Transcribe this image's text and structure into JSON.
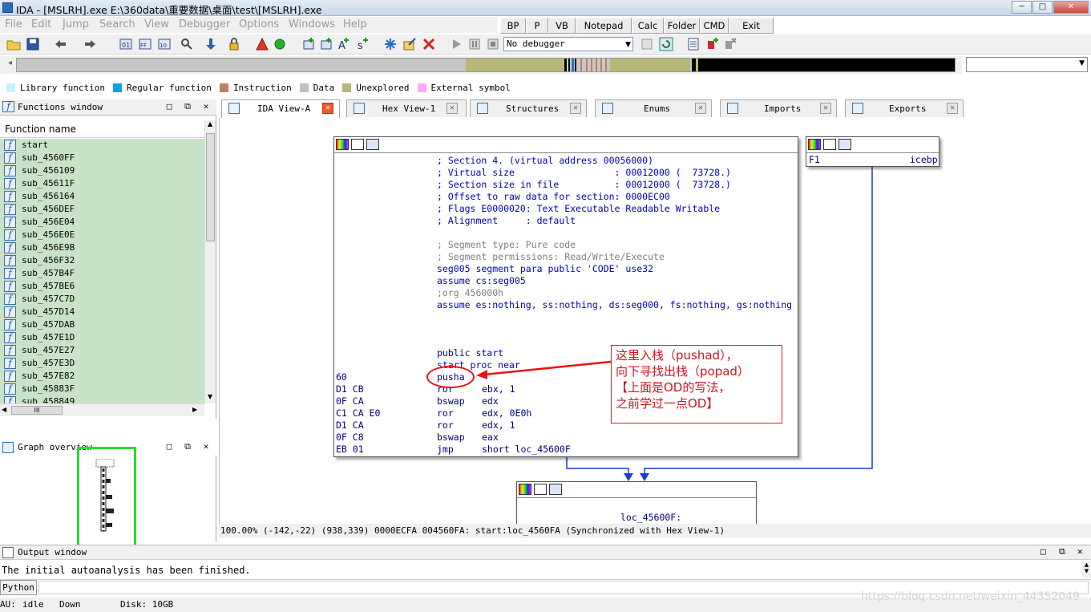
{
  "window": {
    "title": "IDA - [MSLRH].exe E:\\360data\\重要数据\\桌面\\test\\[MSLRH].exe",
    "min": "─",
    "max": "□",
    "close": "✕"
  },
  "menu": [
    "File",
    "Edit",
    "Jump",
    "Search",
    "View",
    "Debugger",
    "Options",
    "Windows",
    "Help"
  ],
  "quickbar": [
    "BP",
    "P",
    "VB",
    "Notepad",
    "Calc",
    "Folder",
    "CMD",
    "Exit"
  ],
  "debugger": {
    "selected": "No debugger"
  },
  "legend": [
    {
      "label": "Library function",
      "color": "#c8f0ff"
    },
    {
      "label": "Regular function",
      "color": "#0aa2e6"
    },
    {
      "label": "Instruction",
      "color": "#c08060"
    },
    {
      "label": "Data",
      "color": "#c0c0c0"
    },
    {
      "label": "Unexplored",
      "color": "#b7b778"
    },
    {
      "label": "External symbol",
      "color": "#ffa8ff"
    }
  ],
  "functions_panel": {
    "title": "Functions window",
    "column": "Function name",
    "items": [
      "start",
      "sub_4560FF",
      "sub_456109",
      "sub_45611F",
      "sub_456164",
      "sub_456DEF",
      "sub_456E04",
      "sub_456E0E",
      "sub_456E9B",
      "sub_456F32",
      "sub_457B4F",
      "sub_457BE6",
      "sub_457C7D",
      "sub_457D14",
      "sub_457DAB",
      "sub_457E1D",
      "sub_457E27",
      "sub_457E3D",
      "sub_457E82",
      "sub_45883F",
      "sub_458849"
    ],
    "hscroll_thumb": "III"
  },
  "graph_overview": {
    "title": "Graph overview"
  },
  "tabs": [
    {
      "label": "IDA View-A"
    },
    {
      "label": "Hex View-1"
    },
    {
      "label": "Structures"
    },
    {
      "label": "Enums"
    },
    {
      "label": "Imports"
    },
    {
      "label": "Exports"
    }
  ],
  "node_main": {
    "comments": [
      "; Section 4. (virtual address 00056000)",
      "; Virtual size                  : 00012000 (  73728.)",
      "; Section size in file          : 00012000 (  73728.)",
      "; Offset to raw data for section: 0000EC00",
      "; Flags E0000020: Text Executable Readable Writable",
      "; Alignment     : default"
    ],
    "seg_comments": [
      "; Segment type: Pure code",
      "; Segment permissions: Read/Write/Execute"
    ],
    "segment": "seg005 segment para public 'CODE' use32",
    "assume1": "assume cs:seg005",
    "org": ";org 456000h",
    "assume2": "assume es:nothing, ss:nothing, ds:seg000, fs:nothing, gs:nothing",
    "public": "public start",
    "proc": "start proc near",
    "instructions": [
      {
        "bytes": "60",
        "mnem": "pusha",
        "ops": ""
      },
      {
        "bytes": "D1 CB",
        "mnem": "ror",
        "ops": "ebx, 1"
      },
      {
        "bytes": "0F CA",
        "mnem": "bswap",
        "ops": "edx"
      },
      {
        "bytes": "C1 CA E0",
        "mnem": "ror",
        "ops": "edx, 0E0h"
      },
      {
        "bytes": "D1 CA",
        "mnem": "ror",
        "ops": "edx, 1"
      },
      {
        "bytes": "0F C8",
        "mnem": "bswap",
        "ops": "eax"
      },
      {
        "bytes": "EB 01",
        "mnem": "jmp",
        "ops": "short loc_45600F"
      }
    ]
  },
  "node_side": {
    "bytes": "F1",
    "mnem": "icebp"
  },
  "node_bottom": {
    "label": "loc_45600F:"
  },
  "annotation": {
    "text": "这里入栈（pushad），\n向下寻找出栈（popad）\n【上面是OD的写法，\n之前学过一点OD】"
  },
  "status_line": "100.00% (-142,-22) (938,339) 0000ECFA 004560FA: start:loc_4560FA (Synchronized with Hex View-1)",
  "output": {
    "title": "Output window",
    "line": "The initial autoanalysis has been finished."
  },
  "python_button": "Python",
  "statusbar": {
    "au": "AU:",
    "state": "idle",
    "dir": "Down",
    "disk": "Disk: 10GB"
  },
  "watermark": "https://blog.csdn.net/weixin_44352049"
}
